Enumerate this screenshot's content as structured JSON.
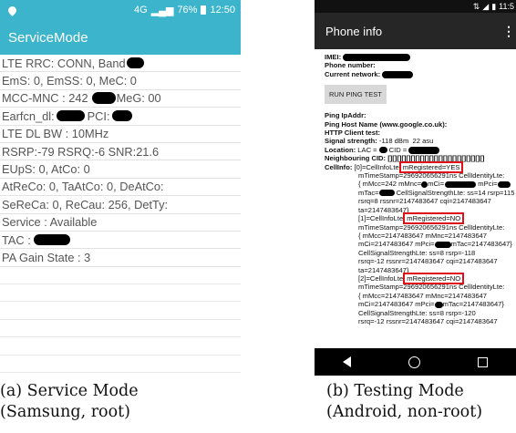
{
  "service_mode": {
    "status_bar": {
      "signal": "4G",
      "battery_pct": "76%",
      "time": "12:50"
    },
    "title": "ServiceMode",
    "rows": [
      "LTE RRC: CONN, Band",
      "EmS: 0, EmSS: 0, MeC: 0",
      "MCC-MNC : 242",
      "MeG: 00",
      "Earfcn_dl:",
      "PCI:",
      "LTE DL BW : 10MHz",
      "RSRP:-79 RSRQ:-6 SNR:21.6",
      "EUpS: 0, AtCo: 0",
      "AtReCo: 0, TaAtCo: 0, DeAtCo:",
      "SeReCa: 0, ReCau: 256, DetTy:",
      "Service : Available",
      "TAC :",
      "PA Gain State : 3"
    ]
  },
  "phone_info": {
    "status_bar": {
      "time": "11:5"
    },
    "title": "Phone info",
    "imei_label": "IMEI:",
    "phone_number_label": "Phone number:",
    "current_network_label": "Current network:",
    "ping_button": "RUN PING TEST",
    "ping_ipaddr": "Ping IpAddr:",
    "ping_hostname": "Ping Host Name (www.google.co.uk):",
    "http_test": "HTTP Client test:",
    "signal_label": "Signal strength:",
    "signal_value": "-118 dBm",
    "signal_asu": "22 asu",
    "location_label": "Location:",
    "lac": "LAC =",
    "cid": "CID =",
    "neighbouring_label": "Neighbouring CID:",
    "neighbouring_value": "[][][][][][][][][][][][][][][][][][][][][]",
    "cellinfo_label": "CellInfo:",
    "cell_blocks": [
      {
        "head": "[0]=CellInfoLte:",
        "registered": "mRegistered=YES",
        "lines": [
          "mTimeStamp=296920656291ns CellIdentityLte:",
          "{ mMcc=242 mMnc=",
          "mCi=",
          "mPci=",
          "mTac=",
          "CellSignalStrengthLte: ss=14 rsrp=115",
          "rsrq=8 rssnr=2147483647 cqi=2147483647",
          "ta=2147483647}"
        ]
      },
      {
        "head": "[1]=CellInfoLte:",
        "registered": "mRegistered=NO",
        "lines": [
          "mTimeStamp=296920656291ns CellIdentityLte:",
          "{ mMcc=2147483647 mMnc=2147483647",
          "mCi=2147483647 mPci=",
          "mTac=2147483647}",
          "CellSignalStrengthLte: ss=8 rsrp=-118",
          "rsrq=-12 rssnr=2147483647 cqi=2147483647",
          "ta=2147483647}"
        ]
      },
      {
        "head": "[2]=CellInfoLte:",
        "registered": "mRegistered=NO",
        "lines": [
          "mTimeStamp=296920656291ns CellIdentityLte:",
          "{ mMcc=2147483647 mMnc=2147483647",
          "mCi=2147483647 mPci=",
          "mTac=2147483647}",
          "CellSignalStrengthLte: ss=8 rsrp=-120",
          "rsrq=-12 rssnr=2147483647 cqi=2147483647"
        ]
      }
    ]
  },
  "captions": {
    "a_line1": "(a) Service Mode",
    "a_line2": "(Samsung, root)",
    "b_line1": "(b) Testing Mode",
    "b_line2": "(Android, non-root)"
  },
  "colors": {
    "service_accent": "#3bb4cc",
    "phone_info_bar": "#262626",
    "highlight_box": "#e0101a",
    "redaction": "#000000"
  }
}
